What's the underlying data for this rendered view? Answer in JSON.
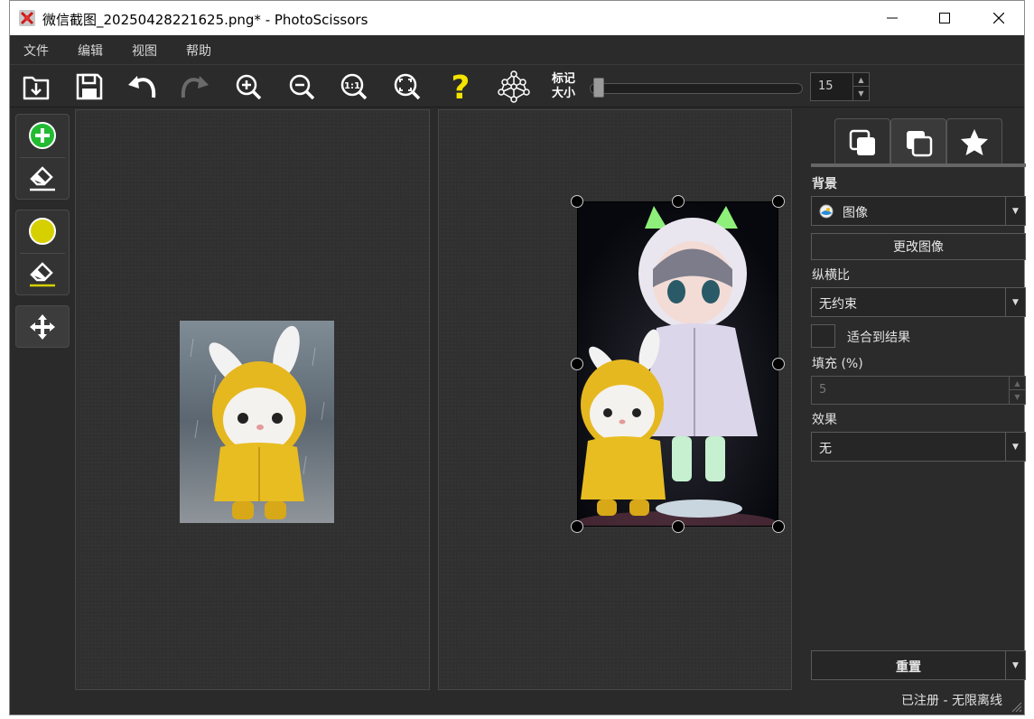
{
  "window": {
    "title": "微信截图_20250428221625.png* - PhotoScissors",
    "minimize": "—",
    "maximize": "☐",
    "close": "✕"
  },
  "menu": [
    "文件",
    "编辑",
    "视图",
    "帮助"
  ],
  "toolbar": {
    "marker_label_line1": "标记",
    "marker_label_line2": "大小",
    "marker_size": "15",
    "marker_slider_level": 0.05
  },
  "tools": {
    "keep_color": "#22bb33",
    "highlight_color": "#d6d000"
  },
  "right_panel": {
    "background_label": "背景",
    "background_value": "图像",
    "change_image": "更改图像",
    "aspect_label": "纵横比",
    "aspect_value": "无约束",
    "fit_result": "适合到结果",
    "padding_label": "填充 (%)",
    "padding_value": "5",
    "effect_label": "效果",
    "effect_value": "无",
    "reset": "重置"
  },
  "status": "已注册 - 无限离线"
}
